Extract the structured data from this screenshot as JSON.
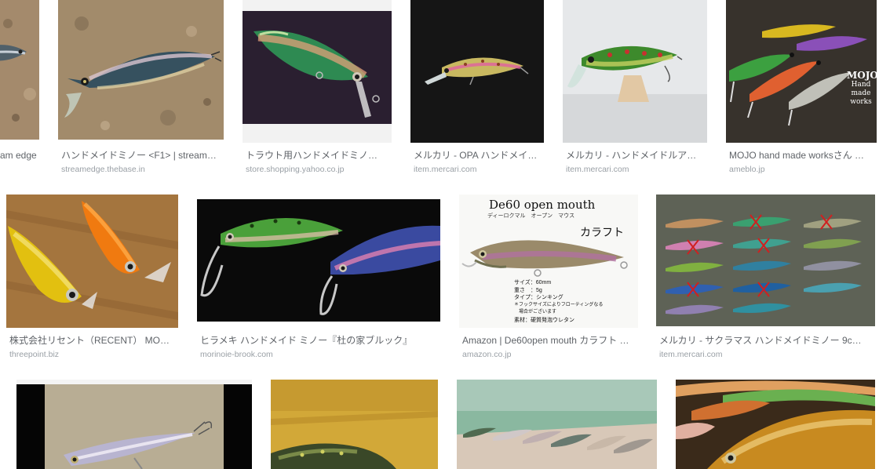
{
  "results": [
    {
      "title": "am edge",
      "source": "",
      "thumb_icon": "fishing-lure-image"
    },
    {
      "title": "ハンドメイドミノー <F1> | stream…",
      "source": "streamedge.thebase.in",
      "thumb_icon": "fishing-lure-image"
    },
    {
      "title": "トラウト用ハンドメイドミノ…",
      "source": "store.shopping.yahoo.co.jp",
      "thumb_icon": "fishing-lure-image"
    },
    {
      "title": "メルカリ - OPA ハンドメイ…",
      "source": "item.mercari.com",
      "thumb_icon": "fishing-lure-image"
    },
    {
      "title": "メルカリ - ハンドメイドルア…",
      "source": "item.mercari.com",
      "thumb_icon": "fishing-lure-image"
    },
    {
      "title": "MOJO hand made worksさん …",
      "source": "ameblo.jp",
      "thumb_icon": "fishing-lure-image",
      "overlay_text": "MOJO\nHand\nmade\nworks"
    },
    {
      "title": "株式会社リセント（RECENT） MO…",
      "source": "threepoint.biz",
      "thumb_icon": "fishing-lure-image"
    },
    {
      "title": "ヒラメキ ハンドメイド ミノー『杜の家ブルック』",
      "source": "morinoie-brook.com",
      "thumb_icon": "fishing-lure-image"
    },
    {
      "title": "Amazon | De60open mouth カラフト …",
      "source": "amazon.co.jp",
      "thumb_icon": "fishing-lure-image",
      "image_text": {
        "heading": "De60 open mouth",
        "sub": "ディーロクマル　オープン　マウス",
        "color_name": "カラフト",
        "specs": [
          "サイズ：60mm",
          "重さ　：5g",
          "タイプ：シンキング",
          "＊フックサイズによりフローティングなる",
          "　場合がございます",
          "素材：硬質発泡ウレタン"
        ]
      }
    },
    {
      "title": "メルカリ - サクラマス ハンドメイドミノー 9c…",
      "source": "item.mercari.com",
      "thumb_icon": "fishing-lure-image"
    },
    {
      "title": "",
      "source": "",
      "thumb_icon": "fishing-lure-image"
    },
    {
      "title": "",
      "source": "",
      "thumb_icon": "fishing-lure-image"
    },
    {
      "title": "",
      "source": "",
      "thumb_icon": "fishing-lure-image"
    },
    {
      "title": "",
      "source": "",
      "thumb_icon": "fishing-lure-image"
    }
  ]
}
